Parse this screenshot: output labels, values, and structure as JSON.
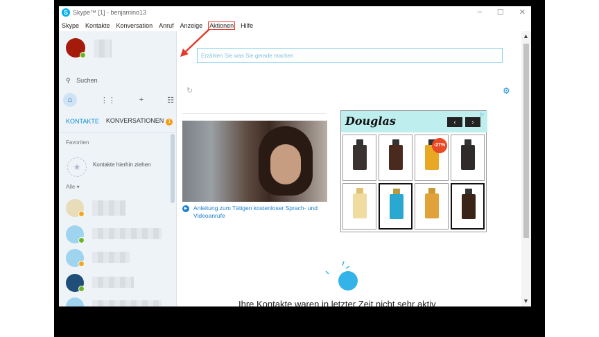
{
  "window": {
    "title": "Skype™ [1] - benjamino13",
    "logo": "S",
    "minimize": "–",
    "maximize": "☐",
    "close": "✕"
  },
  "menu": [
    "Skype",
    "Kontakte",
    "Konversation",
    "Anruf",
    "Anzeige",
    "Aktionen",
    "Hilfe"
  ],
  "sidebar": {
    "search_label": "Suchen",
    "tabs": {
      "contacts": "KONTAKTE",
      "conversations": "KONVERSATIONEN",
      "conversations_badge": "1"
    },
    "favorites_label": "Favoriten",
    "favorites_drop": "Kontakte hierhin ziehen",
    "all_label": "Alle ▾"
  },
  "main": {
    "mood_placeholder": "Erzählen Sie was Sie gerade machen",
    "video_link": "Anleitung zum Tätigen kostenloser Sprach- und Videoanrufe",
    "empty_text": "Ihre Kontakte waren in letzter Zeit nicht sehr aktiv",
    "ad": {
      "brand": "Douglas",
      "prev": "‹",
      "next": "›",
      "discount": "-27%"
    }
  },
  "colors": {
    "accent": "#00aff0",
    "highlight": "#e23a2a",
    "online": "#6cb524",
    "away": "#f5a623"
  }
}
